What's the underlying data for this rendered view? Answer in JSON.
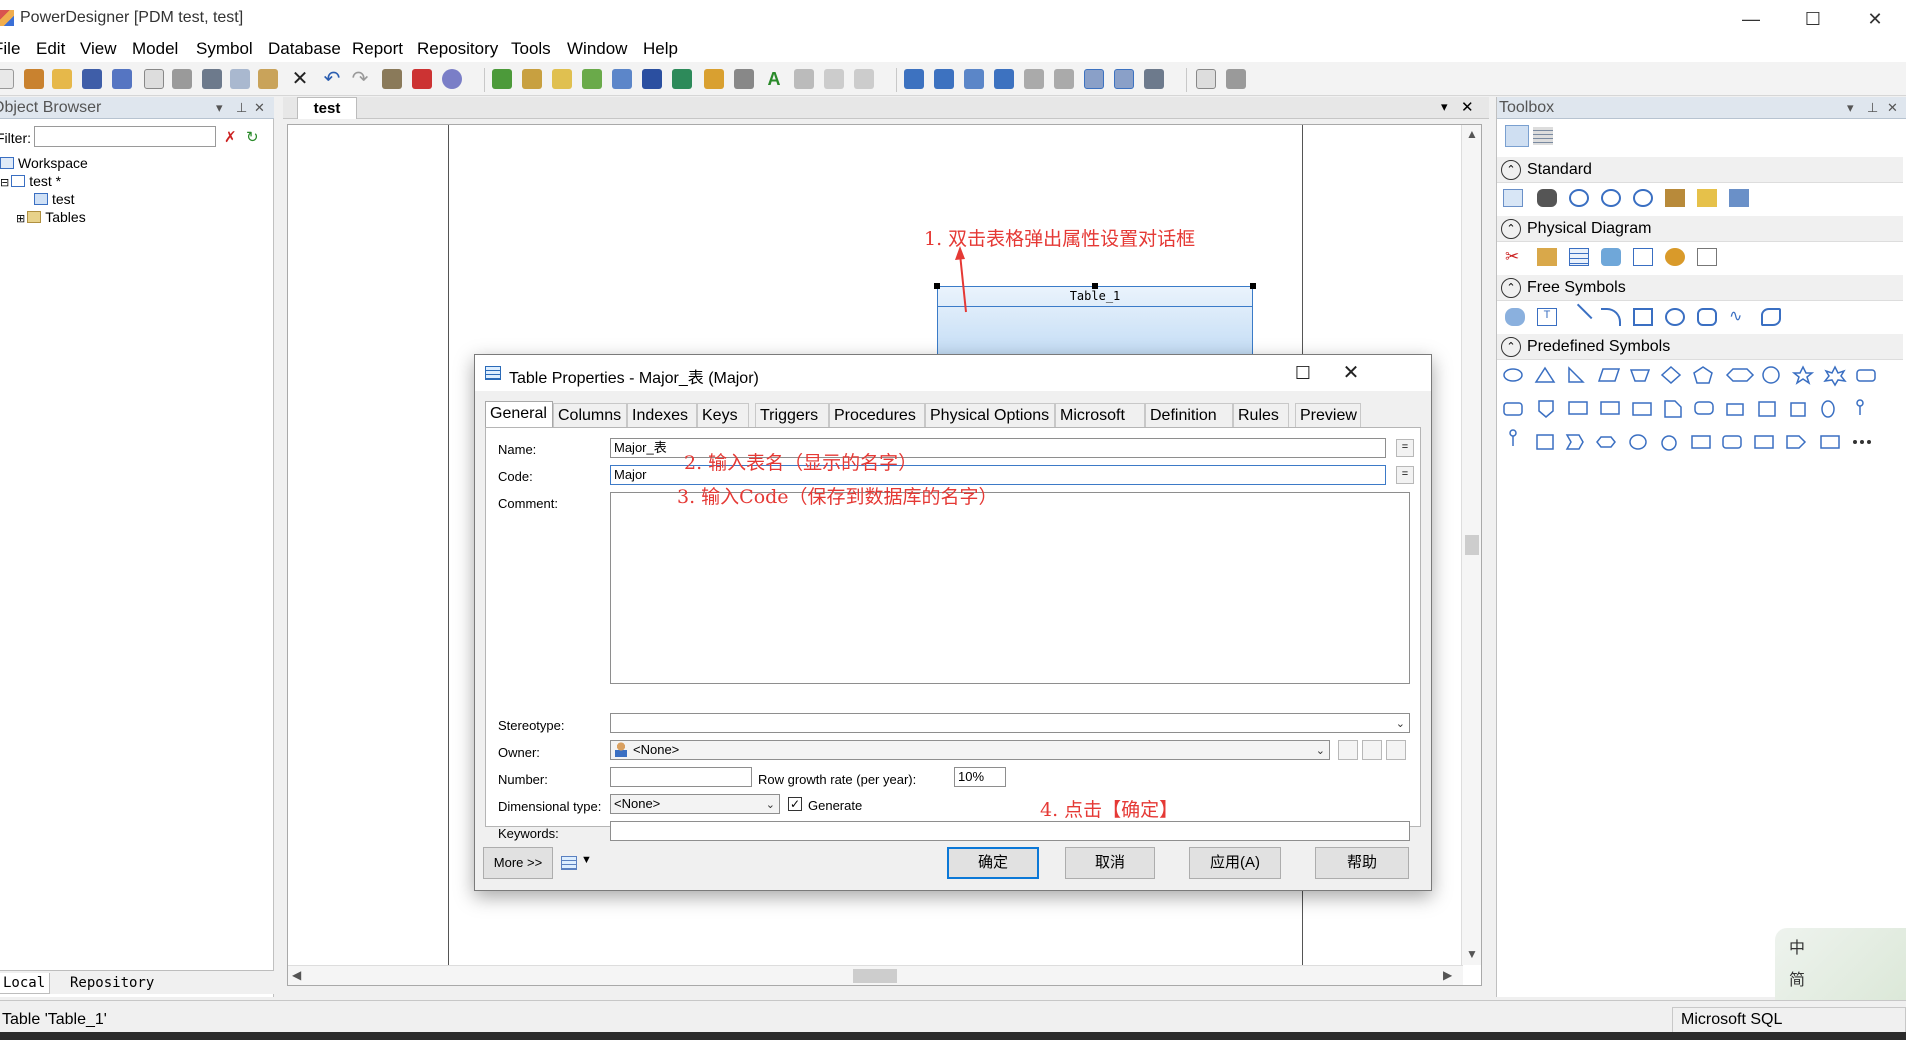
{
  "window": {
    "title": "PowerDesigner [PDM test, test]",
    "minimize": "—",
    "maximize": "☐",
    "close": "✕"
  },
  "menu": [
    "File",
    "Edit",
    "View",
    "Model",
    "Symbol",
    "Database",
    "Report",
    "Repository",
    "Tools",
    "Window",
    "Help"
  ],
  "object_browser": {
    "title": "Object Browser",
    "filter_label": "Filter:",
    "tree": {
      "workspace": "Workspace",
      "model": "test *",
      "diagram": "test",
      "tables": "Tables"
    },
    "tabs": {
      "local": "Local",
      "repository": "Repository"
    }
  },
  "diagram": {
    "tab_name": "test",
    "table_symbol_name": "Table_1"
  },
  "annotations": {
    "step1": "1. 双击表格弹出属性设置对话框",
    "step2": "2. 输入表名（显示的名字）",
    "step3": "3. 输入Code（保存到数据库的名字）",
    "step4": "4. 点击【确定】"
  },
  "toolbox": {
    "title": "Toolbox",
    "sections": {
      "standard": "Standard",
      "physical": "Physical Diagram",
      "free": "Free Symbols",
      "predefined": "Predefined Symbols"
    }
  },
  "dialog": {
    "title": "Table Properties - Major_表 (Major)",
    "tabs": [
      "General",
      "Columns",
      "Indexes",
      "Keys",
      "Triggers",
      "Procedures",
      "Physical Options",
      "Microsoft",
      "Definition",
      "Rules",
      "Preview"
    ],
    "labels": {
      "name": "Name:",
      "code": "Code:",
      "comment": "Comment:",
      "stereotype": "Stereotype:",
      "owner": "Owner:",
      "number": "Number:",
      "row_growth": "Row growth rate (per year):",
      "dimensional": "Dimensional type:",
      "generate": "Generate",
      "keywords": "Keywords:"
    },
    "values": {
      "name": "Major_表",
      "code": "Major",
      "comment": "",
      "stereotype": "",
      "owner": "<None>",
      "number": "",
      "row_growth": "10%",
      "dimensional": "<None>",
      "generate_checked": true,
      "keywords": ""
    },
    "eq": "=",
    "buttons": {
      "more": "More >>",
      "ok": "确定",
      "cancel": "取消",
      "apply": "应用(A)",
      "help": "帮助"
    }
  },
  "status": {
    "selection": "Table 'Table_1'",
    "dbms": "Microsoft SQL"
  },
  "ime": {
    "chars": [
      "中",
      "简",
      "♣"
    ]
  },
  "colors": {
    "annotation": "#e53935",
    "accent": "#0b78d7",
    "table_border": "#3a7bc8"
  }
}
